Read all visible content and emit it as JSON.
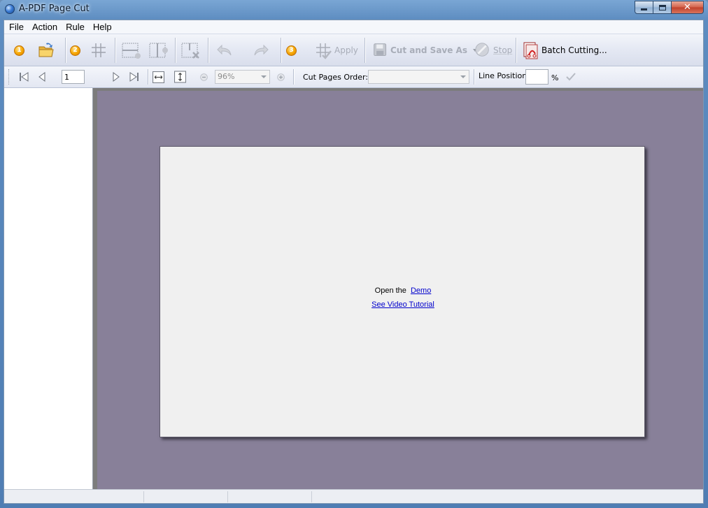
{
  "window": {
    "title": "A-PDF Page Cut"
  },
  "menu": {
    "items": [
      "File",
      "Action",
      "Rule",
      "Help"
    ]
  },
  "toolbar": {
    "step1": "1",
    "step2": "2",
    "step3": "3",
    "apply_label": "Apply",
    "cut_save_label": "Cut and Save As",
    "stop_label": "Stop",
    "batch_label": "Batch Cutting..."
  },
  "navbar": {
    "page_value": "1",
    "zoom_value": "96%",
    "cut_order_label": "Cut Pages Order:",
    "cut_order_value": "",
    "line_position_label": "Line Position:",
    "line_position_value": "",
    "percent_label": "%"
  },
  "viewer": {
    "open_prefix": "Open the",
    "demo_link": "Demo",
    "tutorial_link": "See Video Tutorial"
  },
  "colors": {
    "accent_step": "#f6a500",
    "link": "#0000cc",
    "viewer_bg": "#888099"
  }
}
